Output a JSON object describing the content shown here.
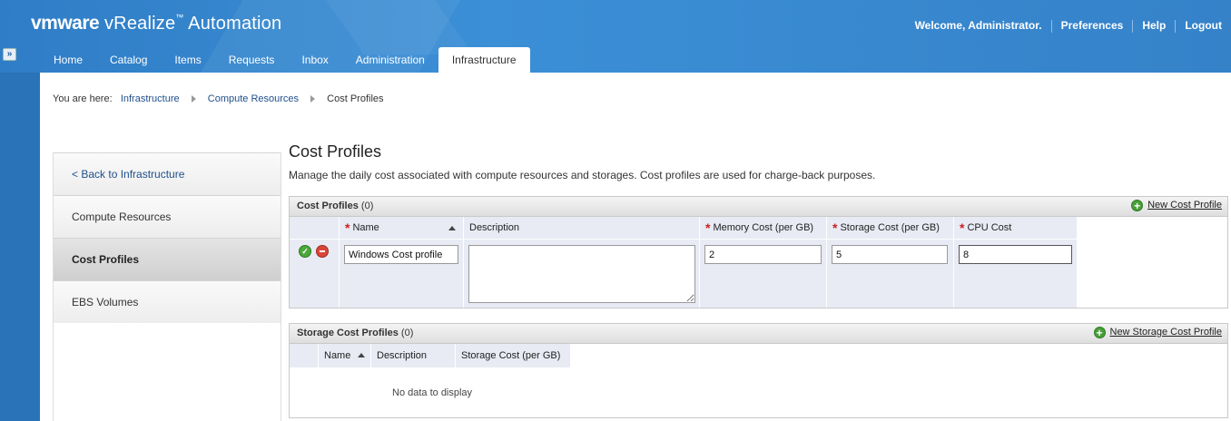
{
  "app": {
    "brand_vm": "vmware",
    "brand_product": "vRealize",
    "brand_tm": "™",
    "brand_suffix": "Automation"
  },
  "user_links": {
    "welcome": "Welcome, Administrator.",
    "preferences": "Preferences",
    "help": "Help",
    "logout": "Logout"
  },
  "nav": {
    "tabs": [
      {
        "label": "Home"
      },
      {
        "label": "Catalog"
      },
      {
        "label": "Items"
      },
      {
        "label": "Requests"
      },
      {
        "label": "Inbox"
      },
      {
        "label": "Administration"
      },
      {
        "label": "Infrastructure",
        "active": true
      }
    ]
  },
  "breadcrumb": {
    "prefix": "You are here:",
    "items": [
      "Infrastructure",
      "Compute Resources",
      "Cost Profiles"
    ]
  },
  "left_panel": {
    "items": [
      {
        "label": "< Back to Infrastructure"
      },
      {
        "label": "Compute Resources"
      },
      {
        "label": "Cost Profiles",
        "active": true
      },
      {
        "label": "EBS Volumes"
      }
    ]
  },
  "page": {
    "title": "Cost Profiles",
    "description": "Manage the daily cost associated with compute resources and storages. Cost profiles are used for charge-back purposes."
  },
  "cost_profiles": {
    "title": "Cost Profiles",
    "count": "(0)",
    "new_label": "New Cost Profile",
    "columns": [
      "Name",
      "Description",
      "Memory Cost (per GB)",
      "Storage Cost (per GB)",
      "CPU Cost"
    ],
    "edit_row": {
      "name": "Windows Cost profile",
      "description": "",
      "memory_cost": "2",
      "storage_cost": "5",
      "cpu_cost": "8"
    }
  },
  "storage_cost_profiles": {
    "title": "Storage Cost Profiles",
    "count": "(0)",
    "new_label": "New Storage Cost Profile",
    "columns": [
      "Name",
      "Description",
      "Storage Cost (per GB)"
    ],
    "empty_text": "No data to display"
  },
  "colors": {
    "header_blue": "#3582c9",
    "link_blue": "#1f4f8b",
    "required_red": "#cc2222",
    "grid_bg": "#e8ebf4"
  }
}
